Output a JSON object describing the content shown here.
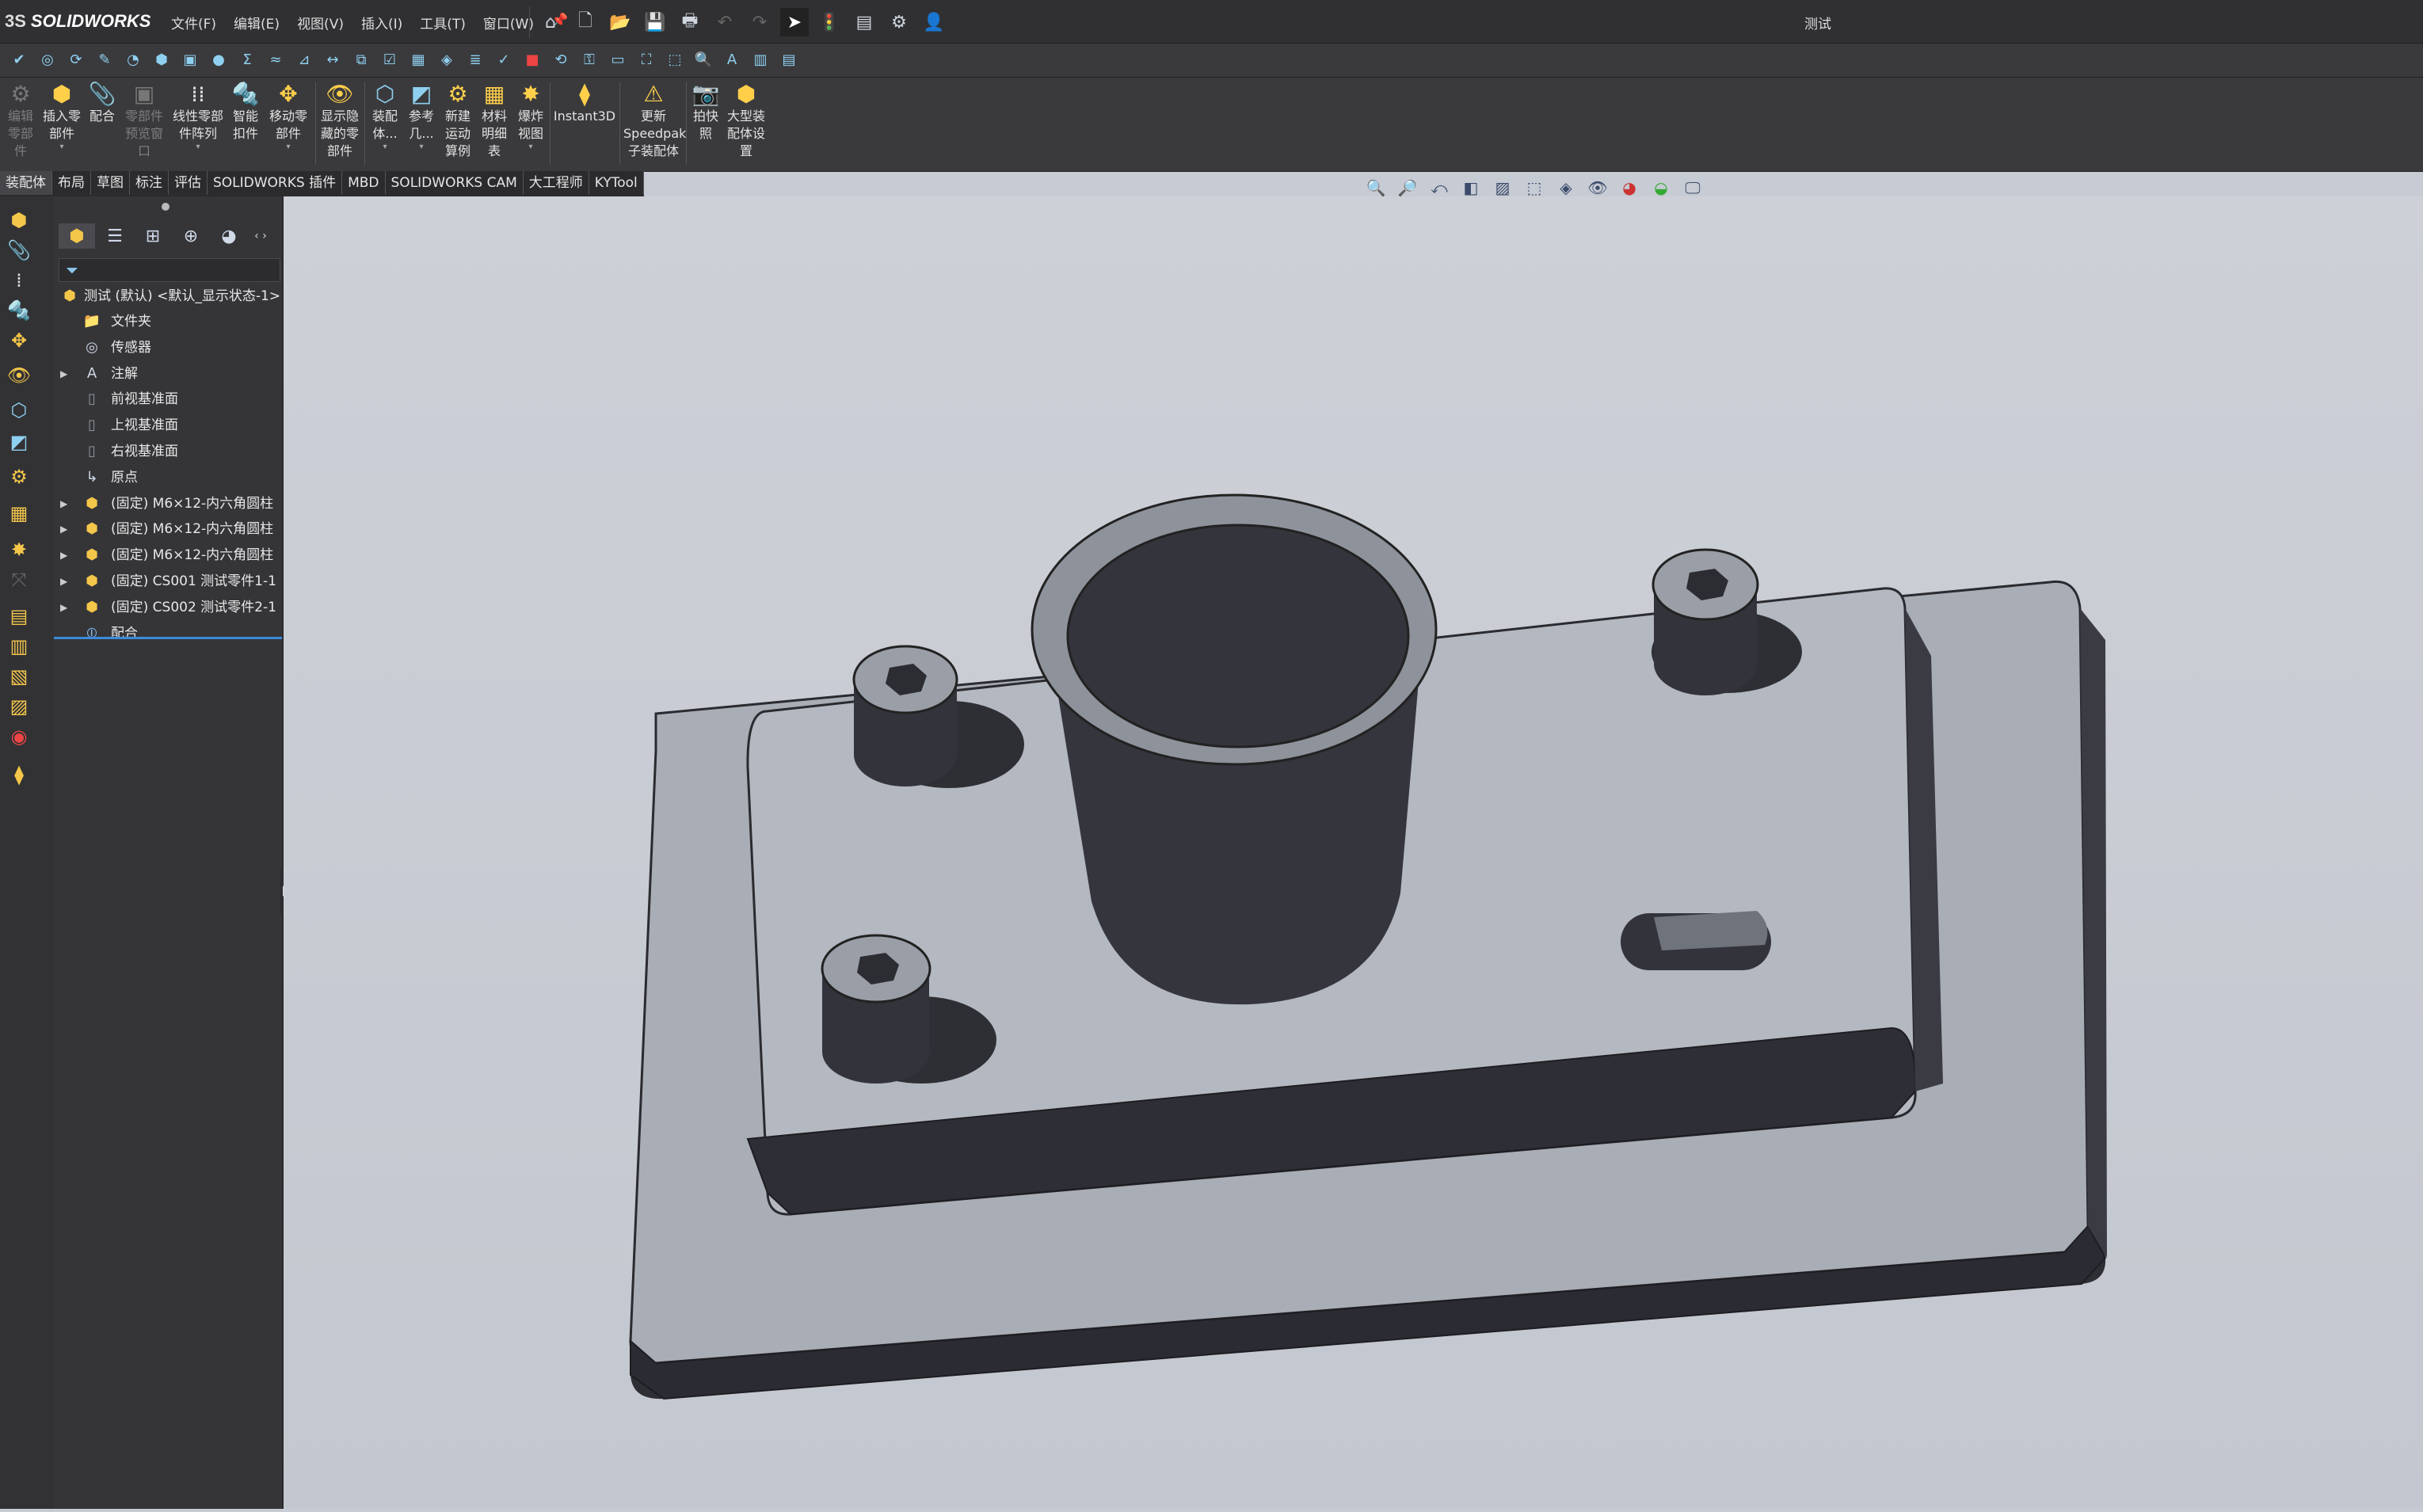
{
  "app": {
    "brand": "SOLIDWORKS",
    "brand_prefix": "3S",
    "document_title": "测试"
  },
  "menu": {
    "file": "文件(F)",
    "edit": "编辑(E)",
    "view": "视图(V)",
    "insert": "插入(I)",
    "tools": "工具(T)",
    "window": "窗口(W)"
  },
  "command_manager": {
    "edit_component": "编辑零部件",
    "insert_components": "插入零部件",
    "mate": "配合",
    "component_preview": "零部件预览窗口",
    "linear_pattern": "线性零部件阵列",
    "smart_fasteners": "智能扣件",
    "move_component": "移动零部件",
    "show_hidden": "显示隐藏的零部件",
    "assembly_features": "装配体...",
    "reference_geometry": "参考几...",
    "new_motion_study": "新建运动算例",
    "bill_of_materials": "材料明细表",
    "exploded_view": "爆炸视图",
    "instant3d": "Instant3D",
    "update_speedpak": "更新Speedpak子装配体",
    "take_snapshot": "拍快照",
    "large_assembly": "大型装配体设置"
  },
  "tabs": [
    "装配体",
    "布局",
    "草图",
    "标注",
    "评估",
    "SOLIDWORKS 插件",
    "MBD",
    "SOLIDWORKS CAM",
    "大工程师",
    "KYTool"
  ],
  "feature_tree": {
    "root": "测试 (默认) <默认_显示状态-1>",
    "items": [
      {
        "label": "文件夹",
        "icon": "folder-icon",
        "expandable": false
      },
      {
        "label": "传感器",
        "icon": "sensor-icon",
        "expandable": false
      },
      {
        "label": "注解",
        "icon": "annotation-icon",
        "expandable": true
      },
      {
        "label": "前视基准面",
        "icon": "plane-icon",
        "expandable": false
      },
      {
        "label": "上视基准面",
        "icon": "plane-icon",
        "expandable": false
      },
      {
        "label": "右视基准面",
        "icon": "plane-icon",
        "expandable": false
      },
      {
        "label": "原点",
        "icon": "origin-icon",
        "expandable": false
      },
      {
        "label": "(固定) M6×12-内六角圆柱",
        "icon": "part-icon",
        "expandable": true
      },
      {
        "label": "(固定) M6×12-内六角圆柱",
        "icon": "part-icon",
        "expandable": true
      },
      {
        "label": "(固定) M6×12-内六角圆柱",
        "icon": "part-icon",
        "expandable": true
      },
      {
        "label": "(固定) CS001 测试零件1-1",
        "icon": "part-icon",
        "expandable": true
      },
      {
        "label": "(固定) CS002 测试零件2-1",
        "icon": "part-icon",
        "expandable": true
      },
      {
        "label": "配合",
        "icon": "mates-icon",
        "expandable": false
      }
    ]
  },
  "colors": {
    "titlebar": "#303033",
    "toolbar": "#3a3a3d",
    "panel": "#353538",
    "viewport": "#c7cbd3",
    "accent": "#3c8ad8",
    "model_top": "#a9adb5",
    "model_side": "#2e2f35"
  }
}
